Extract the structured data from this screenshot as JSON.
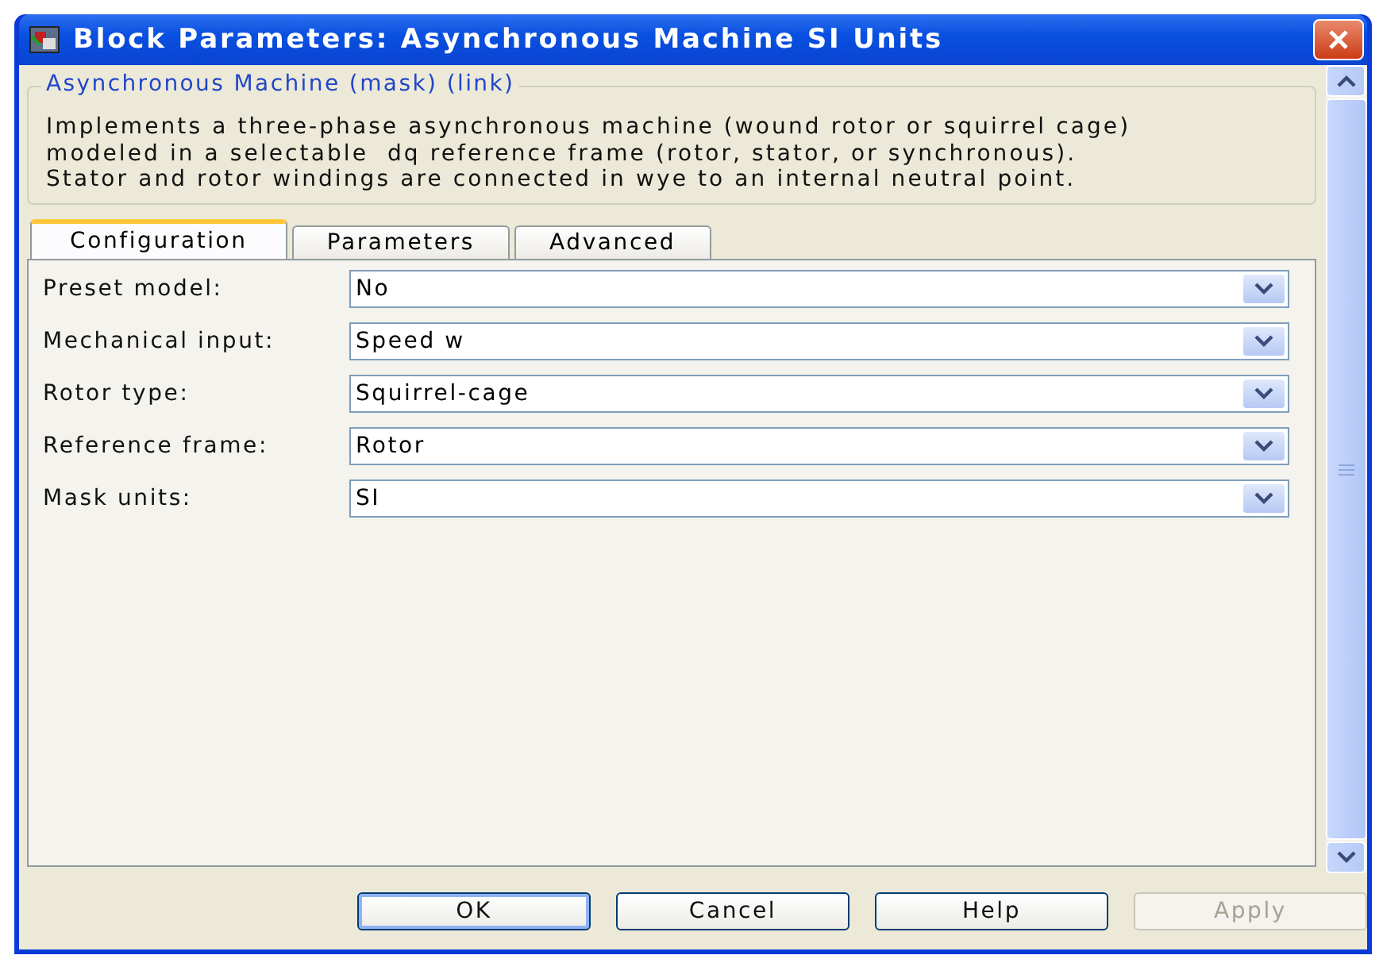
{
  "window": {
    "title": "Block Parameters: Asynchronous Machine SI Units"
  },
  "group": {
    "title": "Asynchronous Machine (mask) (link)",
    "description": "Implements a three-phase asynchronous machine (wound rotor or squirrel cage)\nmodeled in a selectable  dq reference frame (rotor, stator, or synchronous).\nStator and rotor windings are connected in wye to an internal neutral point."
  },
  "tabs": [
    {
      "label": "Configuration",
      "selected": true
    },
    {
      "label": "Parameters",
      "selected": false
    },
    {
      "label": "Advanced",
      "selected": false
    }
  ],
  "fields": [
    {
      "label": "Preset model:",
      "value": "No"
    },
    {
      "label": "Mechanical input:",
      "value": "Speed w"
    },
    {
      "label": "Rotor type:",
      "value": "Squirrel-cage"
    },
    {
      "label": "Reference frame:",
      "value": "Rotor"
    },
    {
      "label": "Mask units:",
      "value": "SI"
    }
  ],
  "buttons": [
    {
      "label": "OK",
      "default": true,
      "disabled": false
    },
    {
      "label": "Cancel",
      "default": false,
      "disabled": false
    },
    {
      "label": "Help",
      "default": false,
      "disabled": false
    },
    {
      "label": "Apply",
      "default": false,
      "disabled": true
    }
  ]
}
